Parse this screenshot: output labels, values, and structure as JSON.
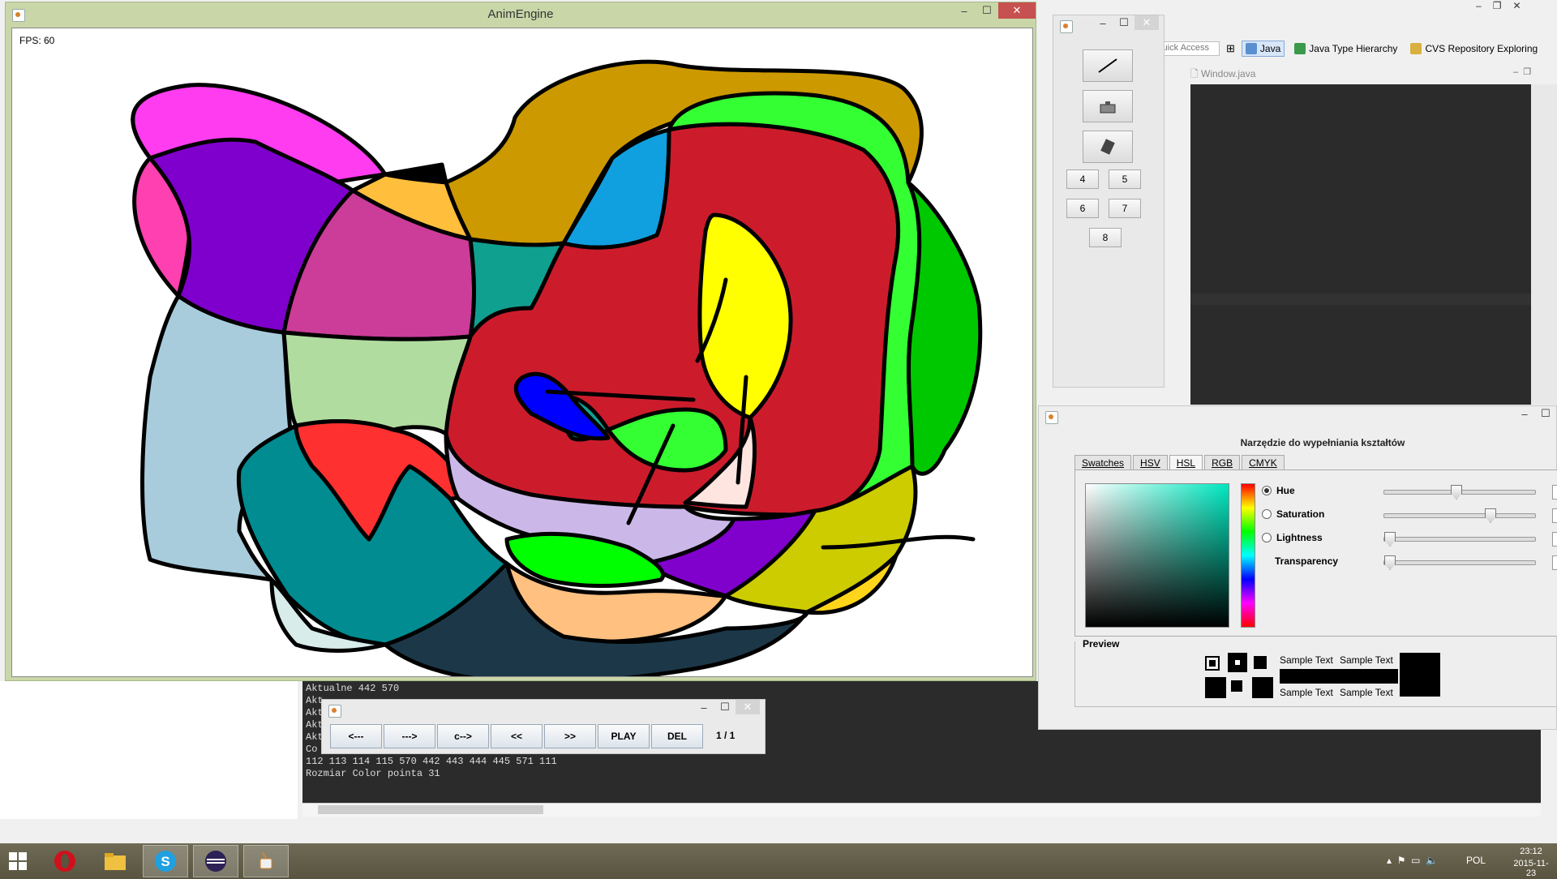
{
  "eclipse": {
    "quick_access": "Quick Access",
    "perspectives": [
      "Java",
      "Java Type Hierarchy",
      "CVS Repository Exploring"
    ],
    "editor_tab": "Window.java",
    "console_lines": [
      "Aktualne 442 570",
      "Akt",
      "Akt",
      "Akt",
      "Akt",
      "Co",
      "112 113 114 115 570 442 443 444 445 571 111",
      "Rozmiar Color pointa 31"
    ]
  },
  "anim": {
    "title": "AnimEngine",
    "fps": "FPS: 60"
  },
  "tools": {
    "numbers": [
      "4",
      "5",
      "6",
      "7",
      "8"
    ]
  },
  "chooser": {
    "title": "Narzędzie do wypełniania kształtów",
    "tabs": [
      "Swatches",
      "HSV",
      "HSL",
      "RGB",
      "CMYK"
    ],
    "active_tab": "HSL",
    "rows": [
      {
        "label": "Hue",
        "value": "169",
        "fraction": 0.39
      },
      {
        "label": "Saturation",
        "value": "68",
        "fraction": 0.68
      },
      {
        "label": "Lightness",
        "value": "0",
        "fraction": 0.0
      },
      {
        "label": "Transparency",
        "value": "0",
        "fraction": 0.0
      }
    ],
    "preview_label": "Preview",
    "sample_text": "Sample Text"
  },
  "player": {
    "buttons": [
      "<---",
      "--->",
      "c-->",
      "<<",
      ">>",
      "PLAY",
      "DEL"
    ],
    "frame": "1 / 1"
  },
  "taskbar": {
    "language": "POL",
    "time": "23:12",
    "date": "2015-11-23"
  },
  "colors": {
    "accent": "#c75050",
    "canvas_bg": "#ffffff"
  }
}
